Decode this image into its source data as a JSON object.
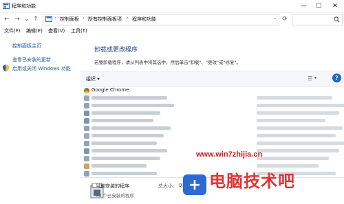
{
  "window": {
    "title": "程序和功能",
    "minimize_glyph": "—",
    "maximize_glyph": "☐",
    "close_glyph": "✕"
  },
  "address": {
    "back_glyph": "←",
    "forward_glyph": "→",
    "dropdown_glyph": "⌄",
    "up_glyph": "↑",
    "breadcrumbs": [
      "控制面板",
      "所有控制面板项",
      "程序和功能"
    ],
    "separator": "›",
    "refresh_glyph": "⟳",
    "search_placeholder": "",
    "search_icon": "search-icon"
  },
  "menu": [
    "文件(F)",
    "编辑(E)",
    "查看(V)",
    "工具(T)"
  ],
  "left_panel": {
    "home": "控制面板主页",
    "installed_updates": "查看已安装的更新",
    "windows_features": "启用或关闭 Windows 功能"
  },
  "main": {
    "title": "卸载或更改程序",
    "description": "若要卸载程序，请从列表中将其选中，然后单击\"卸载\"、\"更改\"或\"修复\"。"
  },
  "toolbar": {
    "organize": "组织 ▾",
    "view_glyph": "☰",
    "view_dd": "▾",
    "help": "?"
  },
  "programs": [
    {
      "name": "Google Chrome",
      "icon_color": "#e94235",
      "blurred": false
    },
    {
      "name": "",
      "icon_color": "#9aa9b8",
      "blurred": true
    },
    {
      "name": "",
      "icon_color": "#8fa4b9",
      "blurred": true
    },
    {
      "name": "",
      "icon_color": "#7a95b0",
      "blurred": true
    },
    {
      "name": "",
      "icon_color": "#7a95b0",
      "blurred": true
    },
    {
      "name": "",
      "icon_color": "#8fa4b9",
      "blurred": true
    },
    {
      "name": "",
      "icon_color": "#9aa9b8",
      "blurred": true
    },
    {
      "name": "",
      "icon_color": "#8fa4b9",
      "blurred": true
    },
    {
      "name": "",
      "icon_color": "#7a95b0",
      "blurred": true
    },
    {
      "name": "",
      "icon_color": "#9aa9b8",
      "blurred": true
    },
    {
      "name": "",
      "icon_color": "#c9a65a",
      "blurred": true
    },
    {
      "name": "",
      "icon_color": "#8fa4b9",
      "blurred": true
    }
  ],
  "status": {
    "title": "当前安装的程序",
    "total_label": "总大小:",
    "total_value": "916",
    "count": "78 个已安装的程序"
  },
  "watermark": {
    "url": "www.win7zhijia.cn",
    "brand": "电脑技术吧",
    "plus": "+"
  },
  "colors": {
    "link": "#1a5a9a",
    "title_blue": "#1c3f8f",
    "help_blue": "#1f66c7",
    "watermark_red": "#e23434"
  }
}
